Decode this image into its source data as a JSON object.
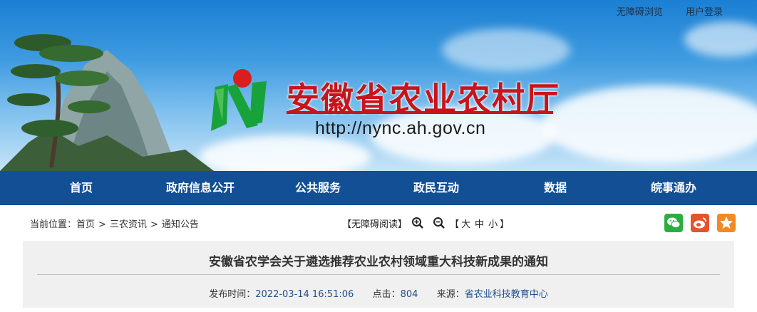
{
  "top_links": {
    "accessibility": "无障碍浏览",
    "login": "用户登录"
  },
  "site": {
    "title": "安徽省农业农村厅",
    "url": "http://nync.ah.gov.cn"
  },
  "nav": [
    "首页",
    "政府信息公开",
    "公共服务",
    "政民互动",
    "数据",
    "皖事通办"
  ],
  "breadcrumb": {
    "prefix": "当前位置：",
    "items": [
      "首页",
      "三农资讯",
      "通知公告"
    ],
    "separator": ">"
  },
  "toolbar": {
    "accessibility_read": "【无障碍阅读】",
    "size_open": "【",
    "sizes": [
      "大",
      "中",
      "小"
    ],
    "size_close": "】"
  },
  "article": {
    "title": "安徽省农学会关于遴选推荐农业农村领域重大科技新成果的通知",
    "publish_label": "发布时间：",
    "publish_time": "2022-03-14 16:51:06",
    "clicks_label": "点击：",
    "clicks": "804",
    "source_label": "来源：",
    "source": "省农业科技教育中心"
  },
  "colors": {
    "nav_bg": "#134f94",
    "title_red": "#c8141b",
    "wechat": "#2aae3f",
    "weibo": "#e6522c",
    "favorite": "#f08a24"
  },
  "icons": [
    "zoom-in-icon",
    "zoom-out-icon",
    "wechat-icon",
    "weibo-icon",
    "favorite-icon"
  ]
}
